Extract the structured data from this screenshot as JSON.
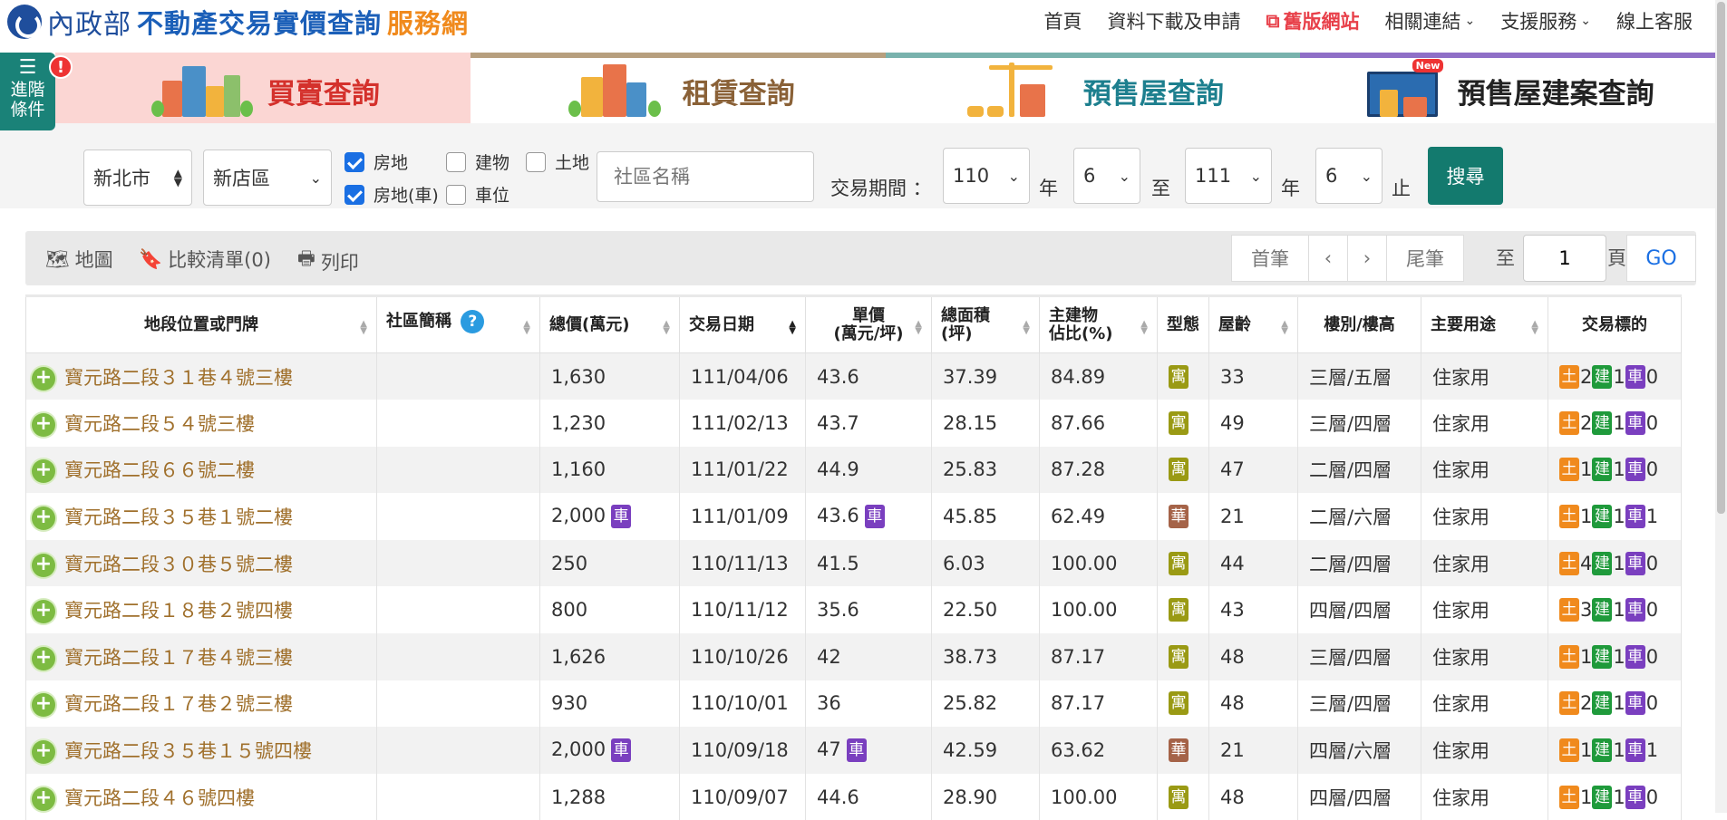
{
  "header": {
    "ministry": "內政部",
    "site_name": "不動產交易實價查詢",
    "site_accent": "服務網",
    "nav": [
      {
        "label": "首頁"
      },
      {
        "label": "資料下載及申請"
      },
      {
        "label": "舊版網站"
      },
      {
        "label": "相關連結",
        "dropdown": true
      },
      {
        "label": "支援服務",
        "dropdown": true
      },
      {
        "label": "線上客服"
      }
    ]
  },
  "advanced": {
    "label_line1": "進階",
    "label_line2": "條件",
    "alert": "!"
  },
  "tabs": [
    {
      "label": "買賣查詢",
      "active": true
    },
    {
      "label": "租賃查詢"
    },
    {
      "label": "預售屋查詢"
    },
    {
      "label": "預售屋建案查詢",
      "badge": "New"
    }
  ],
  "filters": {
    "city": "新北市",
    "district": "新店區",
    "types": [
      {
        "label": "房地",
        "checked": true
      },
      {
        "label": "建物",
        "checked": false
      },
      {
        "label": "土地",
        "checked": false
      },
      {
        "label": "房地(車)",
        "checked": true
      },
      {
        "label": "車位",
        "checked": false
      }
    ],
    "community_placeholder": "社區名稱",
    "period_label": "交易期間 ：",
    "from_year": "110",
    "year_unit": "年",
    "from_month": "6",
    "to_label": "至",
    "to_year": "111",
    "to_month": "6",
    "end_label": "止",
    "search_button": "搜尋"
  },
  "toolbar": {
    "map": "地圖",
    "compare": "比較清單(0)",
    "print": "列印",
    "first": "首筆",
    "prev": "‹",
    "next": "›",
    "last": "尾筆",
    "goto_prefix": "至",
    "page": "1",
    "page_unit": "頁",
    "go": "GO"
  },
  "table": {
    "headers": {
      "address": "地段位置或門牌",
      "community": "社區簡稱",
      "total_price": "總價(萬元)",
      "date": "交易日期",
      "unit_price_1": "單價",
      "unit_price_2": "(萬元/坪)",
      "area_1": "總面積",
      "area_2": "(坪)",
      "main_1": "主建物",
      "main_2": "佔比(%)",
      "type": "型態",
      "age": "屋齡",
      "floor": "樓別/樓高",
      "usage": "主要用途",
      "target": "交易標的"
    },
    "tag_labels": {
      "car": "車",
      "land": "土",
      "bld": "建",
      "car_short": "車",
      "apt": "寓",
      "mansion": "華"
    },
    "rows": [
      {
        "address": "寶元路二段３１巷４號三樓",
        "total": "1,630",
        "car": false,
        "date": "111/04/06",
        "unit": "43.6",
        "area": "37.39",
        "main": "84.89",
        "type": "寓",
        "age": "33",
        "floor": "三層/五層",
        "usage": "住家用",
        "land": "2",
        "bld": "1",
        "park": "0"
      },
      {
        "address": "寶元路二段５４號三樓",
        "total": "1,230",
        "car": false,
        "date": "111/02/13",
        "unit": "43.7",
        "area": "28.15",
        "main": "87.66",
        "type": "寓",
        "age": "49",
        "floor": "三層/四層",
        "usage": "住家用",
        "land": "2",
        "bld": "1",
        "park": "0"
      },
      {
        "address": "寶元路二段６６號二樓",
        "total": "1,160",
        "car": false,
        "date": "111/01/22",
        "unit": "44.9",
        "area": "25.83",
        "main": "87.28",
        "type": "寓",
        "age": "47",
        "floor": "二層/四層",
        "usage": "住家用",
        "land": "1",
        "bld": "1",
        "park": "0"
      },
      {
        "address": "寶元路二段３５巷１號二樓",
        "total": "2,000",
        "car": true,
        "date": "111/01/09",
        "unit": "43.6",
        "area": "45.85",
        "main": "62.49",
        "type": "華",
        "age": "21",
        "floor": "二層/六層",
        "usage": "住家用",
        "land": "1",
        "bld": "1",
        "park": "1"
      },
      {
        "address": "寶元路二段３０巷５號二樓",
        "total": "250",
        "car": false,
        "date": "110/11/13",
        "unit": "41.5",
        "area": "6.03",
        "main": "100.00",
        "type": "寓",
        "age": "44",
        "floor": "二層/四層",
        "usage": "住家用",
        "land": "4",
        "bld": "1",
        "park": "0"
      },
      {
        "address": "寶元路二段１８巷２號四樓",
        "total": "800",
        "car": false,
        "date": "110/11/12",
        "unit": "35.6",
        "area": "22.50",
        "main": "100.00",
        "type": "寓",
        "age": "43",
        "floor": "四層/四層",
        "usage": "住家用",
        "land": "3",
        "bld": "1",
        "park": "0"
      },
      {
        "address": "寶元路二段１７巷４號三樓",
        "total": "1,626",
        "car": false,
        "date": "110/10/26",
        "unit": "42",
        "area": "38.73",
        "main": "87.17",
        "type": "寓",
        "age": "48",
        "floor": "三層/四層",
        "usage": "住家用",
        "land": "1",
        "bld": "1",
        "park": "0"
      },
      {
        "address": "寶元路二段１７巷２號三樓",
        "total": "930",
        "car": false,
        "date": "110/10/01",
        "unit": "36",
        "area": "25.82",
        "main": "87.17",
        "type": "寓",
        "age": "48",
        "floor": "三層/四層",
        "usage": "住家用",
        "land": "2",
        "bld": "1",
        "park": "0"
      },
      {
        "address": "寶元路二段３５巷１５號四樓",
        "total": "2,000",
        "car": true,
        "date": "110/09/18",
        "unit": "47",
        "area": "42.59",
        "main": "63.62",
        "type": "華",
        "age": "21",
        "floor": "四層/六層",
        "usage": "住家用",
        "land": "1",
        "bld": "1",
        "park": "1"
      },
      {
        "address": "寶元路二段４６號四樓",
        "total": "1,288",
        "car": false,
        "date": "110/09/07",
        "unit": "44.6",
        "area": "28.90",
        "main": "100.00",
        "type": "寓",
        "age": "48",
        "floor": "四層/四層",
        "usage": "住家用",
        "land": "1",
        "bld": "1",
        "park": "0"
      }
    ]
  }
}
